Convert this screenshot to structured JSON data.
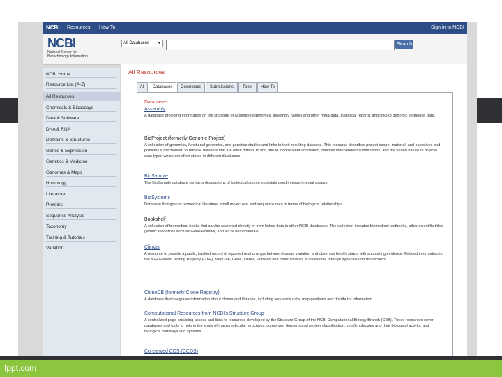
{
  "slide": {
    "footer": "fppt.com"
  },
  "ncbi_bar": {
    "logo": "NCBI",
    "resources": "Resources",
    "how_to": "How To",
    "sign_in": "Sign in to NCBI"
  },
  "header": {
    "logo": "NCBI",
    "logo_sub": "National Center for Biotechnology Information",
    "db_select": "All Databases",
    "search_button": "Search"
  },
  "sidebar": {
    "items": [
      "NCBI Home",
      "Resource List (A-Z)",
      "All Resources",
      "Chemicals & Bioassays",
      "Data & Software",
      "DNA & RNA",
      "Domains & Structures",
      "Genes & Expression",
      "Genetics & Medicine",
      "Genomes & Maps",
      "Homology",
      "Literature",
      "Proteins",
      "Sequence Analysis",
      "Taxonomy",
      "Training & Tutorials",
      "Variation"
    ]
  },
  "main": {
    "title": "All Resources",
    "tabs": [
      "All",
      "Databases",
      "Downloads",
      "Submissions",
      "Tools",
      "How To"
    ],
    "section": "Databases",
    "resources": [
      {
        "title": "Assembly",
        "desc": "A database providing information on the structure of assembled genomes, assembly names and other meta-data, statistical reports, and links to genomic sequence data.",
        "link": true
      },
      {
        "title": "BioProject (formerly Genome Project)",
        "desc": "A collection of genomics, functional genomics, and genetics studies and links to their resulting datasets. This resource describes project scope, material, and objectives and provides a mechanism to retrieve datasets that are often difficult to find due to inconsistent annotation, multiple independent submissions, and the varied nature of diverse data types which are often stored in different databases.",
        "link": false
      },
      {
        "title": "BioSample",
        "desc": "The BioSample database contains descriptions of biological source materials used in experimental assays.",
        "link": true
      },
      {
        "title": "BioSystems",
        "desc": "Database that groups biomedical literature, small molecules, and sequence data in terms of biological relationships.",
        "link": true
      },
      {
        "title": "Bookshelf",
        "desc": "A collection of biomedical books that can be searched directly or from linked data in other NCBI databases. The collection includes biomedical textbooks, other scientific titles, genetic resources such as GeneReviews, and NCBI help manuals.",
        "link": false
      },
      {
        "title": "ClinVar",
        "desc": "A resource to provide a public, tracked record of reported relationships between human variation and observed health status with supporting evidence. Related information in the NIH Genetic Testing Registry (GTR), MedGen, Gene, OMIM, PubMed and other sources is accessible through hyperlinks on the records.",
        "link": true
      },
      {
        "title": "CloneDB (formerly Clone Registry)",
        "desc": "A database that integrates information about clones and libraries, including sequence data, map positions and distributor information.",
        "link": true
      },
      {
        "title": "Computational Resources from NCBI's Structure Group",
        "desc": "A centralized page providing access and links to resources developed by the Structure Group of the NCBI Computational Biology Branch (CBB). These resources cover databases and tools to help in the study of macromolecular structures, conserved domains and protein classification, small molecules and their biological activity, and biological pathways and systems.",
        "link": true
      },
      {
        "title": "Conserved CDS (CCDS)",
        "desc": "",
        "link": true
      }
    ]
  }
}
